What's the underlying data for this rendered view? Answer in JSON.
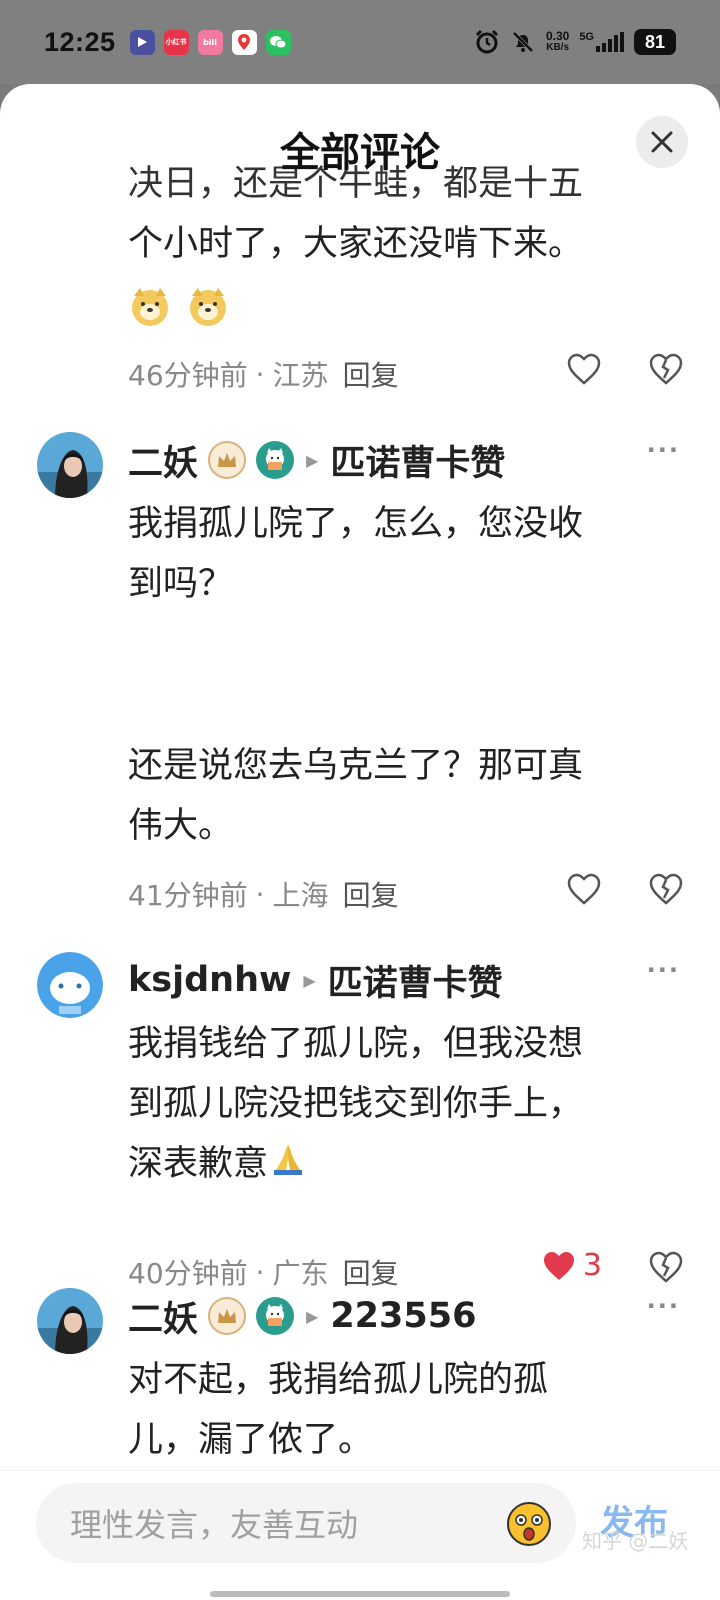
{
  "status_bar": {
    "time": "12:25",
    "app_icons": [
      {
        "name": "tencent-video-icon",
        "color": "#4a4f9e",
        "label": ""
      },
      {
        "name": "xiaohongshu-icon",
        "color": "#e8344a",
        "label": "小红书"
      },
      {
        "name": "bilibili-icon",
        "color": "#f07aa0",
        "label": "bili"
      },
      {
        "name": "map-icon",
        "color": "#ffffff",
        "label": ""
      },
      {
        "name": "wechat-icon",
        "color": "#2bc160",
        "label": ""
      }
    ],
    "net_speed_value": "0.30",
    "net_speed_unit": "KB/s",
    "network": "5G",
    "battery": "81"
  },
  "sheet": {
    "title": "全部评论",
    "close_label": "×"
  },
  "comments": [
    {
      "body_top_partial": "决日，还是个牛蛙，都是十五",
      "body": "个小时了，大家还没啃下来。",
      "time": "46分钟前",
      "location": "江苏",
      "reply_label": "回复",
      "like_count": ""
    },
    {
      "author": "二妖",
      "reply_to": "匹诺曹卡赞",
      "body_1": "我捐孤儿院了，怎么，您没收\n到吗？",
      "body_2": "还是说您去乌克兰了？那可真\n伟大。",
      "time": "41分钟前",
      "location": "上海",
      "reply_label": "回复",
      "like_count": ""
    },
    {
      "author": "ksjdnhw",
      "reply_to": "匹诺曹卡赞",
      "body": "我捐钱给了孤儿院，但我没想\n到孤儿院没把钱交到你手上，\n深表歉意",
      "time": "40分钟前",
      "location": "广东",
      "reply_label": "回复",
      "like_count": "3"
    },
    {
      "author": "二妖",
      "reply_to": "223556",
      "body": "对不起，我捐给孤儿院的孤\n儿，漏了侬了。"
    }
  ],
  "meta_separator": "·",
  "more_label": "···",
  "bottom": {
    "placeholder": "理性发言，友善互动",
    "publish_label": "发布",
    "watermark": "知乎 @二妖"
  },
  "colors": {
    "like_active": "#e33b4e",
    "publish": "#8ab8f0",
    "meta_text": "#888888"
  }
}
